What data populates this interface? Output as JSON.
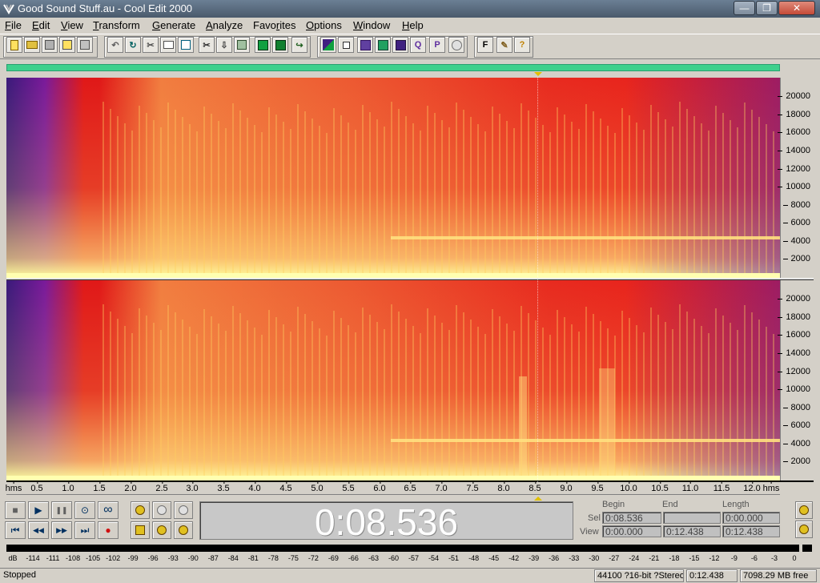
{
  "window": {
    "title": "Good Sound Stuff.au - Cool Edit 2000",
    "minimize": "—",
    "restore": "❐",
    "close": "✕"
  },
  "menu": [
    "File",
    "Edit",
    "View",
    "Transform",
    "Generate",
    "Analyze",
    "Favorites",
    "Options",
    "Window",
    "Help"
  ],
  "toolbar": {
    "buttons": [
      "new-icon",
      "open-icon",
      "save-icon",
      "save-selection-icon",
      "save-all-icon",
      "undo-icon",
      "repeat-icon",
      "cut-icon",
      "copy-icon",
      "copy-new-icon",
      "scissors-icon",
      "mix-paste-icon",
      "paste-icon",
      "snap-icon",
      "spectral-icon",
      "loop-icon",
      "waveform-view-icon",
      "checkbox-icon",
      "grid-a-icon",
      "grid-b-icon",
      "grid-c-icon",
      "grid-d-icon",
      "q-icon",
      "p-icon",
      "cd-icon",
      "f-icon",
      "script-icon",
      "help-icon"
    ],
    "f_label": "F",
    "help_label": "?",
    "q_label": "Q",
    "p_label": "P"
  },
  "spectrogram": {
    "freq_ticks": [
      "20000",
      "18000",
      "16000",
      "14000",
      "12000",
      "10000",
      "8000",
      "6000",
      "4000",
      "2000"
    ],
    "colors": {
      "low": "#4a1a8a",
      "mid": "#e01818",
      "high": "#ffe060"
    }
  },
  "ruler": {
    "start_label": "hms",
    "end_label": "hms",
    "ticks": [
      "0.5",
      "1.0",
      "1.5",
      "2.0",
      "2.5",
      "3.0",
      "3.5",
      "4.0",
      "4.5",
      "5.0",
      "5.5",
      "6.0",
      "6.5",
      "7.0",
      "7.5",
      "8.0",
      "8.5",
      "9.0",
      "9.5",
      "10.0",
      "10.5",
      "11.0",
      "11.5",
      "12.0"
    ]
  },
  "transport": {
    "stop": "■",
    "play": "▶",
    "pause": "❚❚",
    "play_to_end": "⊙",
    "loop": "∞",
    "go_start": "⏮",
    "rewind": "◀◀",
    "ffwd": "▶▶",
    "go_end": "⏭",
    "record": "●"
  },
  "time_display": "0:08.536",
  "selection": {
    "headers": {
      "begin": "Begin",
      "end": "End",
      "length": "Length"
    },
    "sel_label": "Sel",
    "view_label": "View",
    "sel_begin": "0:08.536",
    "sel_end": "",
    "sel_length": "0:00.000",
    "view_begin": "0:00.000",
    "view_end": "0:12.438",
    "view_length": "0:12.438"
  },
  "meter": {
    "labels": [
      "dB",
      "-114",
      "-111",
      "-108",
      "-105",
      "-102",
      "-99",
      "-96",
      "-93",
      "-90",
      "-87",
      "-84",
      "-81",
      "-78",
      "-75",
      "-72",
      "-69",
      "-66",
      "-63",
      "-60",
      "-57",
      "-54",
      "-51",
      "-48",
      "-45",
      "-42",
      "-39",
      "-36",
      "-33",
      "-30",
      "-27",
      "-24",
      "-21",
      "-18",
      "-15",
      "-12",
      "-9",
      "-6",
      "-3",
      "0"
    ]
  },
  "status": {
    "state": "Stopped",
    "format": "44100 ?16-bit ?Stereo",
    "duration": "0:12.438",
    "free": "7098.29 MB free"
  }
}
